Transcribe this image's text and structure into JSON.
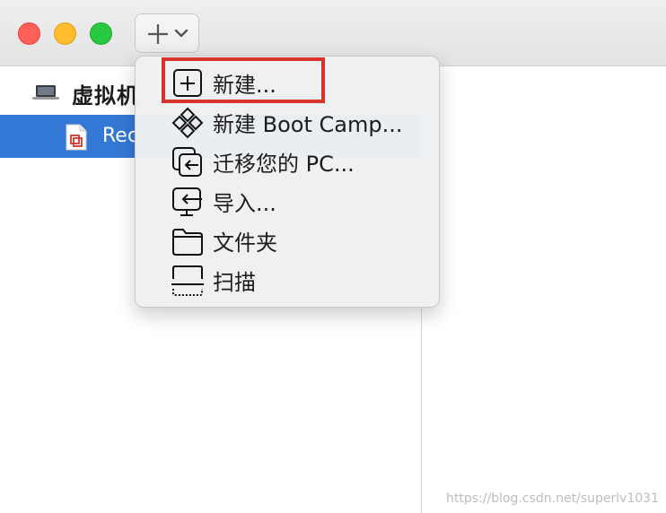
{
  "window": {
    "traffic_lights": {
      "close_color": "#fe5f57",
      "minimize_color": "#febc2e",
      "zoom_color": "#28c840"
    },
    "toolbar": {
      "add_button_icons": [
        "plus-icon",
        "chevron-down-icon"
      ]
    }
  },
  "sidebar": {
    "section_title": "虚拟机",
    "section_icon": "laptop-icon",
    "selected_item": {
      "label": "Rec",
      "icon": "vm-document-icon",
      "highlight_color": "#3478d6"
    }
  },
  "menu": {
    "items": [
      {
        "label": "新建...",
        "icon": "plus-square-icon"
      },
      {
        "label": "新建 Boot Camp...",
        "icon": "bootcamp-diamond-icon"
      },
      {
        "label": "迁移您的 PC...",
        "icon": "migrate-pc-icon"
      },
      {
        "label": "导入...",
        "icon": "import-icon"
      },
      {
        "label": "文件夹",
        "icon": "folder-icon"
      },
      {
        "label": "扫描",
        "icon": "scan-icon"
      }
    ],
    "highlighted_item_index": 0,
    "highlight_color": "#d9322a"
  },
  "watermark": {
    "text": "https://blog.csdn.net/superlv1031"
  }
}
